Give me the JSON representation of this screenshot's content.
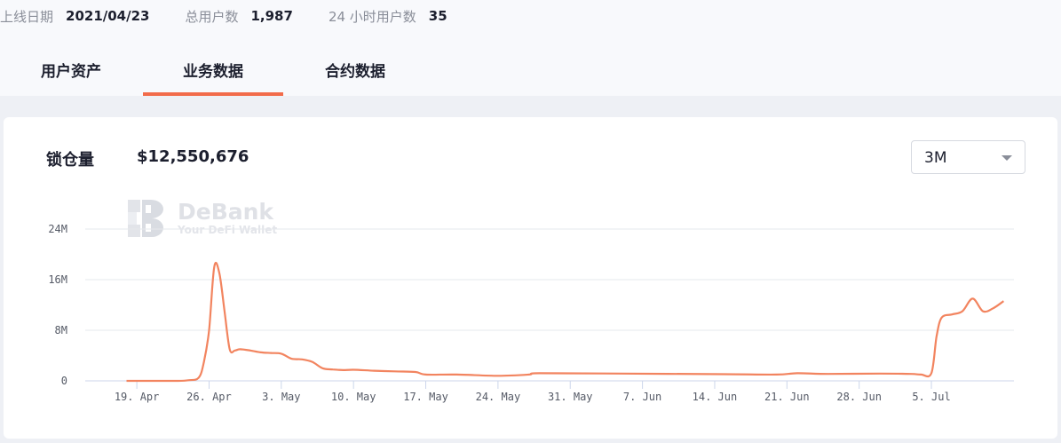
{
  "stats": [
    {
      "label": "上线日期",
      "value": "2021/04/23"
    },
    {
      "label": "总用户数",
      "value": "1,987"
    },
    {
      "label": "24 小时用户数",
      "value": "35"
    }
  ],
  "tabs": [
    {
      "label": "用户资产",
      "active": false
    },
    {
      "label": "业务数据",
      "active": true
    },
    {
      "label": "合约数据",
      "active": false
    }
  ],
  "tvl": {
    "label": "锁仓量",
    "value": "$12,550,676"
  },
  "range_select": {
    "value": "3M"
  },
  "watermark": {
    "title": "DeBank",
    "subtitle": "Your DeFi Wallet"
  },
  "colors": {
    "accent": "#f26b4a",
    "line": "#f2845f"
  },
  "chart_data": {
    "type": "line",
    "title": "",
    "xlabel": "",
    "ylabel": "",
    "ylim": [
      0,
      24000000
    ],
    "y_ticks": [
      {
        "value": 0,
        "label": "0"
      },
      {
        "value": 8000000,
        "label": "8M"
      },
      {
        "value": 16000000,
        "label": "16M"
      },
      {
        "value": 24000000,
        "label": "24M"
      }
    ],
    "x_start": "2021-04-14",
    "x_end": "2021-07-13",
    "x_ticks": [
      {
        "date": "2021-04-19",
        "label": "19. Apr"
      },
      {
        "date": "2021-04-26",
        "label": "26. Apr"
      },
      {
        "date": "2021-05-03",
        "label": "3. May"
      },
      {
        "date": "2021-05-10",
        "label": "10. May"
      },
      {
        "date": "2021-05-17",
        "label": "17. May"
      },
      {
        "date": "2021-05-24",
        "label": "24. May"
      },
      {
        "date": "2021-05-31",
        "label": "31. May"
      },
      {
        "date": "2021-06-07",
        "label": "7. Jun"
      },
      {
        "date": "2021-06-14",
        "label": "14. Jun"
      },
      {
        "date": "2021-06-21",
        "label": "21. Jun"
      },
      {
        "date": "2021-06-28",
        "label": "28. Jun"
      },
      {
        "date": "2021-07-05",
        "label": "5. Jul"
      }
    ],
    "grid": true,
    "legend": "none",
    "series": [
      {
        "x": [
          "2021-04-18",
          "2021-04-20",
          "2021-04-23",
          "2021-04-24",
          "2021-04-25",
          "2021-04-25T12:00",
          "2021-04-26",
          "2021-04-26T12:00",
          "2021-04-27",
          "2021-04-27T12:00",
          "2021-04-28",
          "2021-04-28T12:00",
          "2021-04-29",
          "2021-04-30",
          "2021-05-01",
          "2021-05-02",
          "2021-05-03",
          "2021-05-04",
          "2021-05-05",
          "2021-05-06",
          "2021-05-07",
          "2021-05-08",
          "2021-05-09",
          "2021-05-10",
          "2021-05-12",
          "2021-05-14",
          "2021-05-16",
          "2021-05-17",
          "2021-05-20",
          "2021-05-24",
          "2021-05-27",
          "2021-05-28",
          "2021-06-05",
          "2021-06-15",
          "2021-06-20",
          "2021-06-22",
          "2021-06-25",
          "2021-06-30",
          "2021-07-03",
          "2021-07-04",
          "2021-07-05",
          "2021-07-05T12:00",
          "2021-07-06",
          "2021-07-07",
          "2021-07-08",
          "2021-07-09",
          "2021-07-10",
          "2021-07-11",
          "2021-07-12"
        ],
        "y": [
          0,
          0,
          0,
          100000,
          500000,
          3000000,
          8000000,
          18000000,
          17000000,
          11000000,
          5000000,
          4800000,
          5000000,
          4800000,
          4500000,
          4400000,
          4300000,
          3500000,
          3400000,
          3000000,
          2000000,
          1800000,
          1700000,
          1750000,
          1600000,
          1500000,
          1400000,
          1000000,
          1000000,
          800000,
          1000000,
          1200000,
          1150000,
          1050000,
          1000000,
          1200000,
          1100000,
          1150000,
          1100000,
          1000000,
          1200000,
          7000000,
          10000000,
          10500000,
          11000000,
          13000000,
          11000000,
          11500000,
          12600000
        ]
      }
    ]
  }
}
